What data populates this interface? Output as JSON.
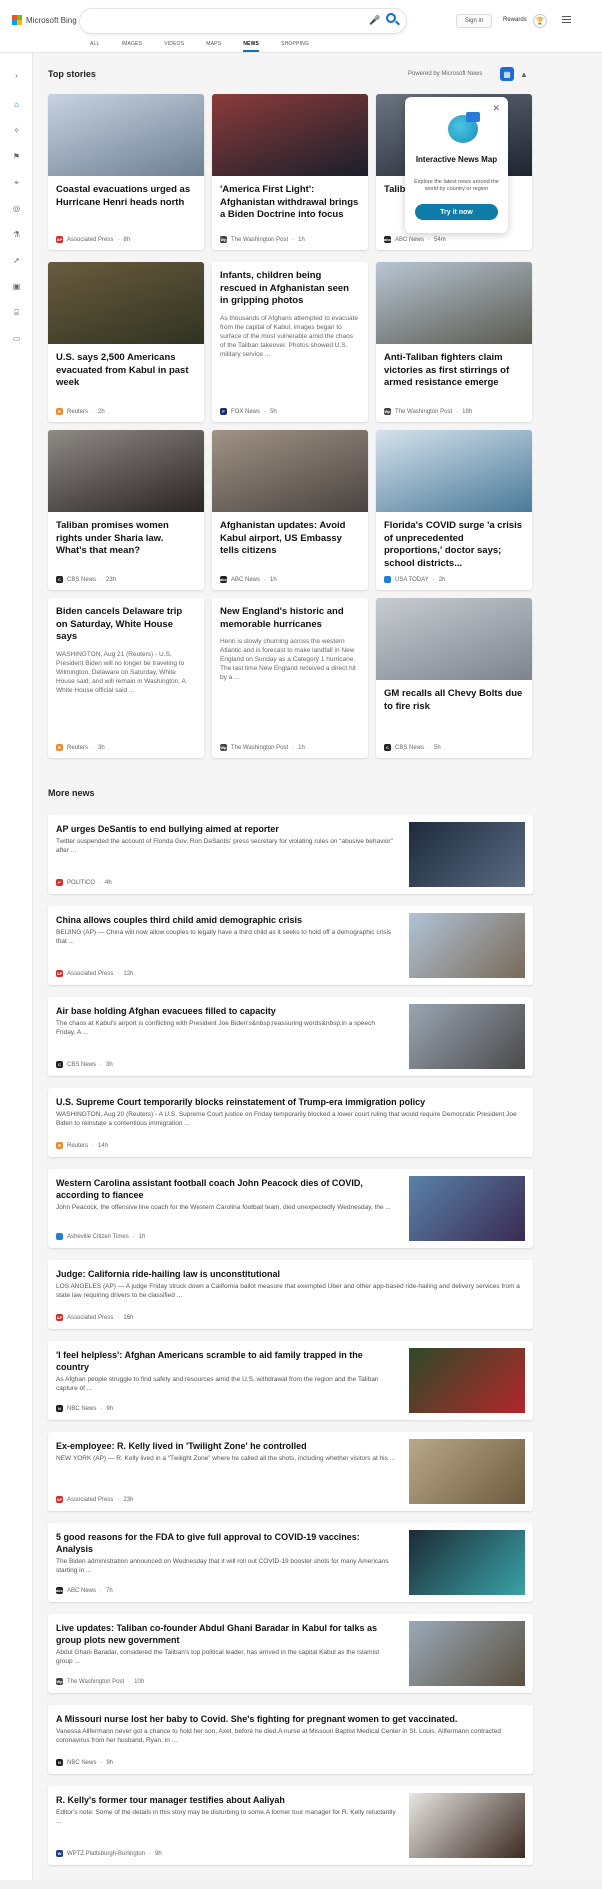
{
  "header": {
    "brand": "Microsoft Bing",
    "search_placeholder": "",
    "signin": "Sign in",
    "rewards": "Rewards",
    "tabs": [
      {
        "label": "ALL",
        "active": false
      },
      {
        "label": "IMAGES",
        "active": false
      },
      {
        "label": "VIDEOS",
        "active": false
      },
      {
        "label": "MAPS",
        "active": false
      },
      {
        "label": "NEWS",
        "active": true
      },
      {
        "label": "SHOPPING",
        "active": false
      }
    ]
  },
  "rail": {
    "icons": [
      "chevron-right-icon",
      "home-icon",
      "sparkle-icon",
      "flag-icon",
      "map-pin-icon",
      "globe-icon",
      "flask-icon",
      "rocket-icon",
      "film-icon",
      "bank-icon",
      "card-icon"
    ]
  },
  "top_stories": {
    "title": "Top stories",
    "powered": "Powered by Microsoft News",
    "cards": [
      {
        "title": "Coastal evacuations urged as Hurricane Henri heads north",
        "snippet": "",
        "source": "Associated Press",
        "time": "8h",
        "src_color": "#d62c2c",
        "src_letter": "AP",
        "img_colors": [
          "#c7d3e1",
          "#6e7f92"
        ]
      },
      {
        "title": "'America First Light': Afghanistan withdrawal brings a Biden Doctrine into focus",
        "snippet": "",
        "source": "The Washington Post",
        "time": "1h",
        "src_color": "#444",
        "src_letter": "Wp",
        "img_colors": [
          "#8c3b3b",
          "#1a1f2b"
        ]
      },
      {
        "title": "Talib black offic",
        "snippet": "",
        "source": "ABC News",
        "time": "54m",
        "src_color": "#222",
        "src_letter": "abc",
        "img_colors": [
          "#6b7480",
          "#1e2430"
        ]
      },
      {
        "title": "U.S. says 2,500 Americans evacuated from Kabul in past week",
        "snippet": "",
        "source": "Reuters",
        "time": "2h",
        "src_color": "#f08a2b",
        "src_letter": "R",
        "img_colors": [
          "#6a5b3e",
          "#2f3322"
        ]
      },
      {
        "title": "Infants, children being rescued in Afghanistan seen in gripping photos",
        "snippet": "As thousands of Afghans attempted to evacuate from the capital of Kabul, images began to surface of the most vulnerable amid the chaos of the Taliban takeover. Photos showed U.S. military service ...",
        "source": "FOX News",
        "time": "5h",
        "src_color": "#1c2f6b",
        "src_letter": "F",
        "img_colors": []
      },
      {
        "title": "Anti-Taliban fighters claim victories as first stirrings of armed resistance emerge",
        "snippet": "",
        "source": "The Washington Post",
        "time": "18h",
        "src_color": "#444",
        "src_letter": "Wp",
        "img_colors": [
          "#b8c6d3",
          "#5a5a50"
        ]
      },
      {
        "title": "Taliban promises women rights under Sharia law. What's that mean?",
        "snippet": "",
        "source": "CBS News",
        "time": "23h",
        "src_color": "#222",
        "src_letter": "C",
        "img_colors": [
          "#8e8a86",
          "#2a2422"
        ]
      },
      {
        "title": "Afghanistan updates: Avoid Kabul airport, US Embassy tells citizens",
        "snippet": "",
        "source": "ABC News",
        "time": "1h",
        "src_color": "#222",
        "src_letter": "abc",
        "img_colors": [
          "#a09386",
          "#4a4440"
        ]
      },
      {
        "title": "Florida's COVID surge 'a crisis of unprecedented proportions,' doctor says; school districts...",
        "snippet": "",
        "source": "USA TODAY",
        "time": "2h",
        "src_color": "#1d82d4",
        "src_letter": "",
        "img_colors": [
          "#d5e2ec",
          "#4a7a99"
        ]
      },
      {
        "title": "Biden cancels Delaware trip on Saturday, White House says",
        "snippet": "WASHINGTON, Aug 21 (Reuters) - U.S. President Biden will no longer be traveling to Wilmington, Delaware on Saturday, White House said, and will remain in Washington. A White House official said ...",
        "source": "Reuters",
        "time": "3h",
        "src_color": "#f08a2b",
        "src_letter": "R",
        "img_colors": []
      },
      {
        "title": "New England's historic and memorable hurricanes",
        "snippet": "Henri is slowly churning across the western Atlantic and is forecast to make landfall in New England on Sunday as a Category 1 hurricane. The last time New England received a direct hit by a ...",
        "source": "The Washington Post",
        "time": "1h",
        "src_color": "#444",
        "src_letter": "Wp",
        "img_colors": []
      },
      {
        "title": "GM recalls all Chevy Bolts due to fire risk",
        "snippet": "",
        "source": "CBS News",
        "time": "5h",
        "src_color": "#222",
        "src_letter": "C",
        "img_colors": [
          "#c8ccd1",
          "#7c848d"
        ]
      }
    ],
    "popup": {
      "title": "Interactive News Map",
      "desc": "Explore the latest news around the world by country or region",
      "button": "Try it now"
    }
  },
  "more_news": {
    "title": "More news",
    "items": [
      {
        "title": "AP urges DeSantis to end bullying aimed at reporter",
        "snippet": "Twitter suspended the account of Florida Gov. Ron DeSantis' press secretary for violating rules on “abusive behavior” after ...",
        "source": "POLITICO",
        "time": "4h",
        "src_color": "#d62c2c",
        "src_letter": "P",
        "has_img": true,
        "img_colors": [
          "#1e2b3d",
          "#5a6a80"
        ]
      },
      {
        "title": "China allows couples third child amid demographic crisis",
        "snippet": "BEIJING (AP) — China will now allow couples to legally have a third child as it seeks to hold off a demographic crisis that ...",
        "source": "Associated Press",
        "time": "12h",
        "src_color": "#d62c2c",
        "src_letter": "AP",
        "has_img": true,
        "img_colors": [
          "#b0c3d6",
          "#7a6a5a"
        ]
      },
      {
        "title": "Air base holding Afghan evacuees filled to capacity",
        "snippet": "The chaos at Kabul's airport is conflicting with President Joe Biden's&nbsp;reassuring words&nbsp;in a speech Friday. A ...",
        "source": "CBS News",
        "time": "3h",
        "src_color": "#222",
        "src_letter": "C",
        "has_img": true,
        "img_colors": [
          "#9aa5b3",
          "#4b4a4a"
        ]
      },
      {
        "title": "U.S. Supreme Court temporarily blocks reinstatement of Trump-era immigration policy",
        "snippet": "WASHINGTON, Aug 20 (Reuters) - A U.S. Supreme Court justice on Friday temporarily blocked a lower court ruling that would require Democratic President Joe Biden to reinstate a contentious immigration ...",
        "source": "Reuters",
        "time": "14h",
        "src_color": "#f08a2b",
        "src_letter": "R",
        "has_img": false,
        "img_colors": []
      },
      {
        "title": "Western Carolina assistant football coach John Peacock dies of COVID, according to fiancee",
        "snippet": "John Peacock, the offensive line coach for the Western Carolina football team, died unexpectedly Wednesday, the ...",
        "source": "Asheville Citizen Times",
        "time": "1h",
        "src_color": "#1d82d4",
        "src_letter": "",
        "has_img": true,
        "img_colors": [
          "#5a82a8",
          "#3a2a52"
        ]
      },
      {
        "title": "Judge: California ride-hailing law is unconstitutional",
        "snippet": "LOS ANGELES (AP) — A judge Friday struck down a California ballot measure that exempted Uber and other app-based ride-hailing and delivery services from a state law requiring drivers to be classified ...",
        "source": "Associated Press",
        "time": "16h",
        "src_color": "#d62c2c",
        "src_letter": "AP",
        "has_img": false,
        "img_colors": []
      },
      {
        "title": "'I feel helpless': Afghan Americans scramble to aid family trapped in the country",
        "snippet": "As Afghan people struggle to find safety and resources amid the U.S. withdrawal from the region and the Taliban capture of ...",
        "source": "NBC News",
        "time": "9h",
        "src_color": "#222",
        "src_letter": "N",
        "has_img": true,
        "img_colors": [
          "#2e4a2a",
          "#b3262a"
        ]
      },
      {
        "title": "Ex-employee: R. Kelly lived in 'Twilight Zone' he controlled",
        "snippet": "NEW YORK (AP) — R. Kelly lived in a “Twilight Zone” where he called all the shots, including whether visitors at his ...",
        "source": "Associated Press",
        "time": "23h",
        "src_color": "#d62c2c",
        "src_letter": "AP",
        "has_img": true,
        "img_colors": [
          "#b8a98a",
          "#6e5a3e"
        ]
      },
      {
        "title": "5 good reasons for the FDA to give full approval to COVID-19 vaccines: Analysis",
        "snippet": "The Biden administration announced on Wednesday that it will roll out COVID-19 booster shots for many Americans starting in ...",
        "source": "ABC News",
        "time": "7h",
        "src_color": "#222",
        "src_letter": "abc",
        "has_img": true,
        "img_colors": [
          "#1d2b35",
          "#3aa2a8"
        ]
      },
      {
        "title": "Live updates: Taliban co-founder Abdul Ghani Baradar in Kabul for talks as group plots new government",
        "snippet": "Abdul Ghani Baradar, considered the Taliban's top political leader, has arrived in the capital Kabul as the Islamist group ...",
        "source": "The Washington Post",
        "time": "10h",
        "src_color": "#444",
        "src_letter": "Wp",
        "has_img": true,
        "img_colors": [
          "#9aa9b8",
          "#5a5040"
        ]
      },
      {
        "title": "A Missouri nurse lost her baby to Covid. She's fighting for pregnant women to get vaccinated.",
        "snippet": "Vanessa Allfermann never got a chance to hold her son, Axel, before he died.A nurse at Missouri Baptist Medical Center in St. Louis, Allfermann contracted coronavirus from her husband, Ryan, in ...",
        "source": "NBC News",
        "time": "9h",
        "src_color": "#222",
        "src_letter": "N",
        "has_img": false,
        "img_colors": []
      },
      {
        "title": "R. Kelly's former tour manager testifies about Aaliyah",
        "snippet": "Editor's note: Some of the details in this story may be disturbing to some.A former tour manager for R. Kelly reluctantly ...",
        "source": "WPTZ Plattsburgh-Burlington",
        "time": "9h",
        "src_color": "#1c3b8a",
        "src_letter": "W",
        "has_img": true,
        "img_colors": [
          "#e8e6e3",
          "#3a2a22"
        ]
      }
    ]
  }
}
